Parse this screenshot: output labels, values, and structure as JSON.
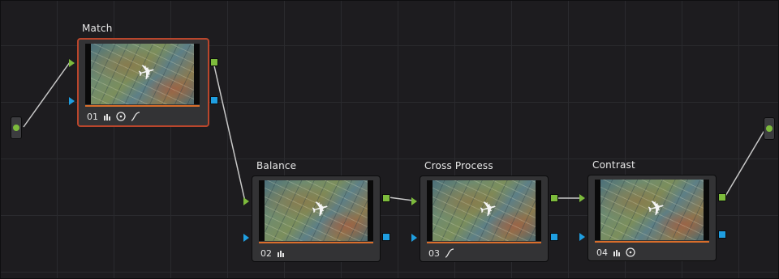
{
  "colors": {
    "canvas_bg": "#1d1c1f",
    "node_bg": "#333335",
    "selected_border": "#b9462c",
    "progress_bar": "#d96e2b",
    "rgb_port": "#7dbb3c",
    "alpha_port": "#1f9ee0",
    "wire": "#c8c8c8"
  },
  "nodes": [
    {
      "title": "Match",
      "number": "01",
      "selected": true,
      "icons": [
        "primaries-bars-icon",
        "color-wheel-icon",
        "curve-icon"
      ]
    },
    {
      "title": "Balance",
      "number": "02",
      "selected": false,
      "icons": [
        "primaries-bars-icon"
      ]
    },
    {
      "title": "Cross Process",
      "number": "03",
      "selected": false,
      "icons": [
        "curve-icon"
      ]
    },
    {
      "title": "Contrast",
      "number": "04",
      "selected": false,
      "icons": [
        "primaries-bars-icon",
        "color-wheel-icon"
      ]
    }
  ],
  "io_nodes": [
    {
      "role": "source-input",
      "icon": "green-dot-icon"
    },
    {
      "role": "final-output",
      "icon": "green-dot-icon"
    }
  ]
}
